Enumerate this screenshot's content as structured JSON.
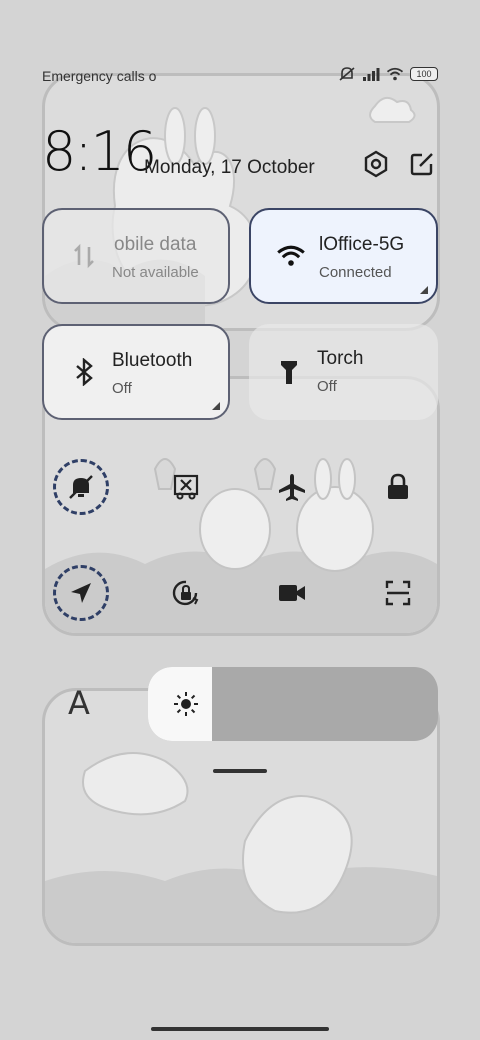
{
  "status_bar": {
    "carrier_text": "Emergency calls o",
    "icons": [
      "mute-icon",
      "signal-icon",
      "wifi-icon",
      "battery-icon"
    ],
    "battery_level": "100"
  },
  "header": {
    "time": "8:16",
    "date": "Monday, 17 October",
    "icons": [
      "settings-icon",
      "edit-icon"
    ]
  },
  "tiles": [
    {
      "title": "obile data",
      "subtitle": "Not available",
      "icon": "mobile-data-icon",
      "state": "inactive"
    },
    {
      "title": "lOffice-5G",
      "subtitle": "Connected",
      "icon": "wifi-icon",
      "state": "active"
    },
    {
      "title": "Bluetooth",
      "subtitle": "Off",
      "icon": "bluetooth-icon",
      "state": "inactive"
    },
    {
      "title": "Torch",
      "subtitle": "Off",
      "icon": "torch-icon",
      "state": "inactive"
    }
  ],
  "toggles_row1": [
    "silent-mode-icon",
    "screenshot-icon",
    "airplane-mode-icon",
    "lock-screen-icon"
  ],
  "toggles_row2": [
    "location-icon",
    "auto-rotate-icon",
    "screen-recorder-icon",
    "scanner-icon"
  ],
  "brightness": {
    "auto_label": "A",
    "level": 0.22,
    "icon": "sun-icon"
  },
  "colors": {
    "active_tile": "#eef3fd",
    "tile": "#e4e4e4",
    "accent": "#2f3f66"
  }
}
